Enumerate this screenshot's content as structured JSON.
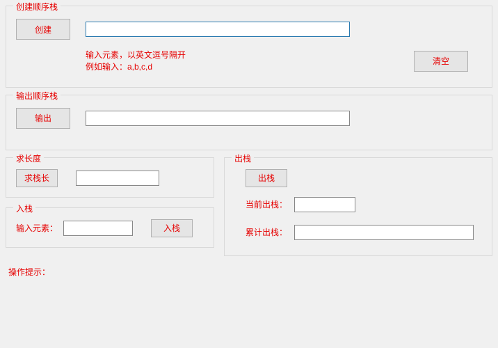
{
  "create": {
    "legend": "创建顺序栈",
    "create_btn": "创建",
    "input_value": "",
    "hint_line1": "输入元素，以英文逗号隔开",
    "hint_line2": "例如输入：a,b,c,d",
    "clear_btn": "清空"
  },
  "output": {
    "legend": "输出顺序栈",
    "output_btn": "输出",
    "value": ""
  },
  "length": {
    "legend": "求长度",
    "btn": "求栈长",
    "value": ""
  },
  "push": {
    "legend": "入栈",
    "label": "输入元素：",
    "value": "",
    "btn": "入栈"
  },
  "pop": {
    "legend": "出栈",
    "btn": "出栈",
    "current_label": "当前出栈：",
    "current_value": "",
    "cumulative_label": "累计出栈：",
    "cumulative_value": ""
  },
  "tips": {
    "label": "操作提示："
  }
}
